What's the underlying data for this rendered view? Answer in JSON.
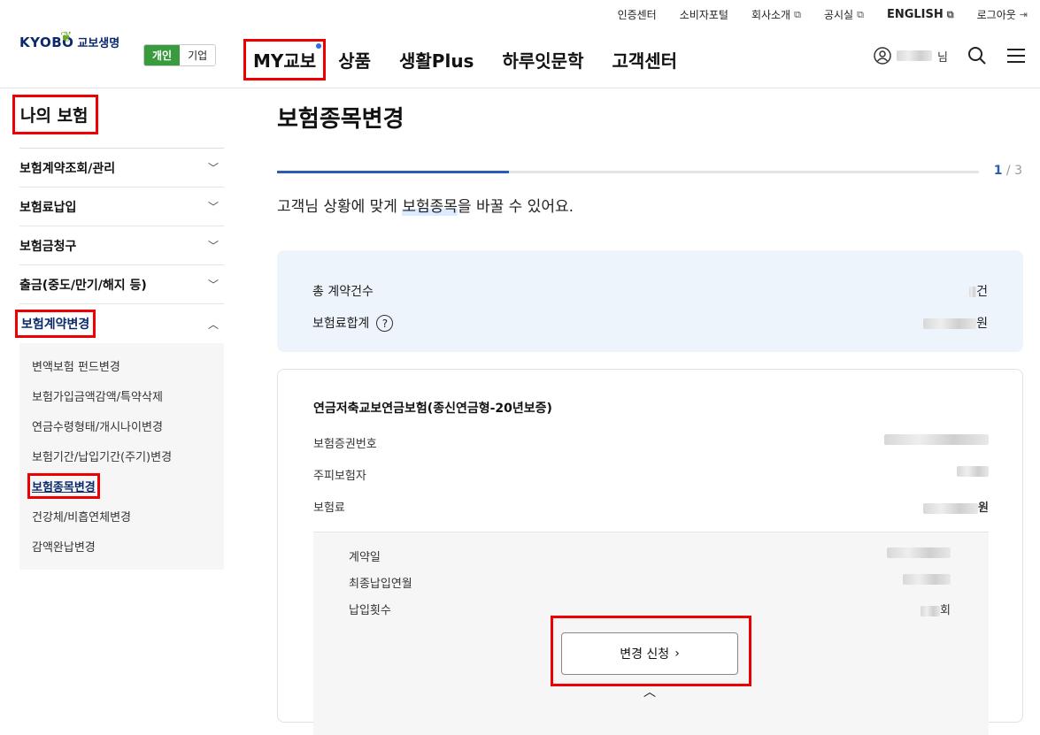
{
  "util": {
    "links": [
      "인증센터",
      "소비자포털",
      "회사소개",
      "공시실",
      "ENGLISH",
      "로그아웃"
    ]
  },
  "logo": {
    "word": "KYOBO",
    "kr": "교보생명"
  },
  "segment": {
    "personal": "개인",
    "corporate": "기업"
  },
  "gnb": [
    "MY교보",
    "상품",
    "생활Plus",
    "하루잇문학",
    "고객센터"
  ],
  "user": {
    "suffix": "님"
  },
  "sidebar": {
    "title": "나의 보험",
    "items": [
      "보험계약조회/관리",
      "보험료납입",
      "보험금청구",
      "출금(중도/만기/해지 등)",
      "보험계약변경"
    ],
    "sub": [
      "변액보험 펀드변경",
      "보험가입금액감액/특약삭제",
      "연금수령형태/개시나이변경",
      "보험기간/납입기간(주기)변경",
      "보험종목변경",
      "건강체/비흡연체변경",
      "감액완납변경"
    ]
  },
  "page": {
    "title": "보험종목변경",
    "progress": 0.33,
    "step_current": "1",
    "step_total": "/ 3",
    "desc_pre": "고객님 상황에 맞게 ",
    "desc_hl": "보험종목",
    "desc_post": "을 바꿀 수 있어요."
  },
  "summary": {
    "count_label": "총 계약건수",
    "count_unit": "건",
    "premium_label": "보험료합계",
    "premium_unit": "원",
    "help": "?"
  },
  "card": {
    "name": "연금저축교보연금보험(종신연금형-20년보증)",
    "policy_label": "보험증권번호",
    "insured_label": "주피보험자",
    "premium_label": "보험료",
    "premium_unit": "원",
    "contract_date_label": "계약일",
    "last_pay_label": "최종납입연월",
    "pay_count_label": "납입횟수",
    "pay_count_unit": "회",
    "button": "변경 신청",
    "button_arrow": "›"
  },
  "colors": {
    "accent": "#2a5bb8",
    "brand": "#0b2a6b",
    "green": "#3a9a3e",
    "highlight_box": "#e00000"
  }
}
